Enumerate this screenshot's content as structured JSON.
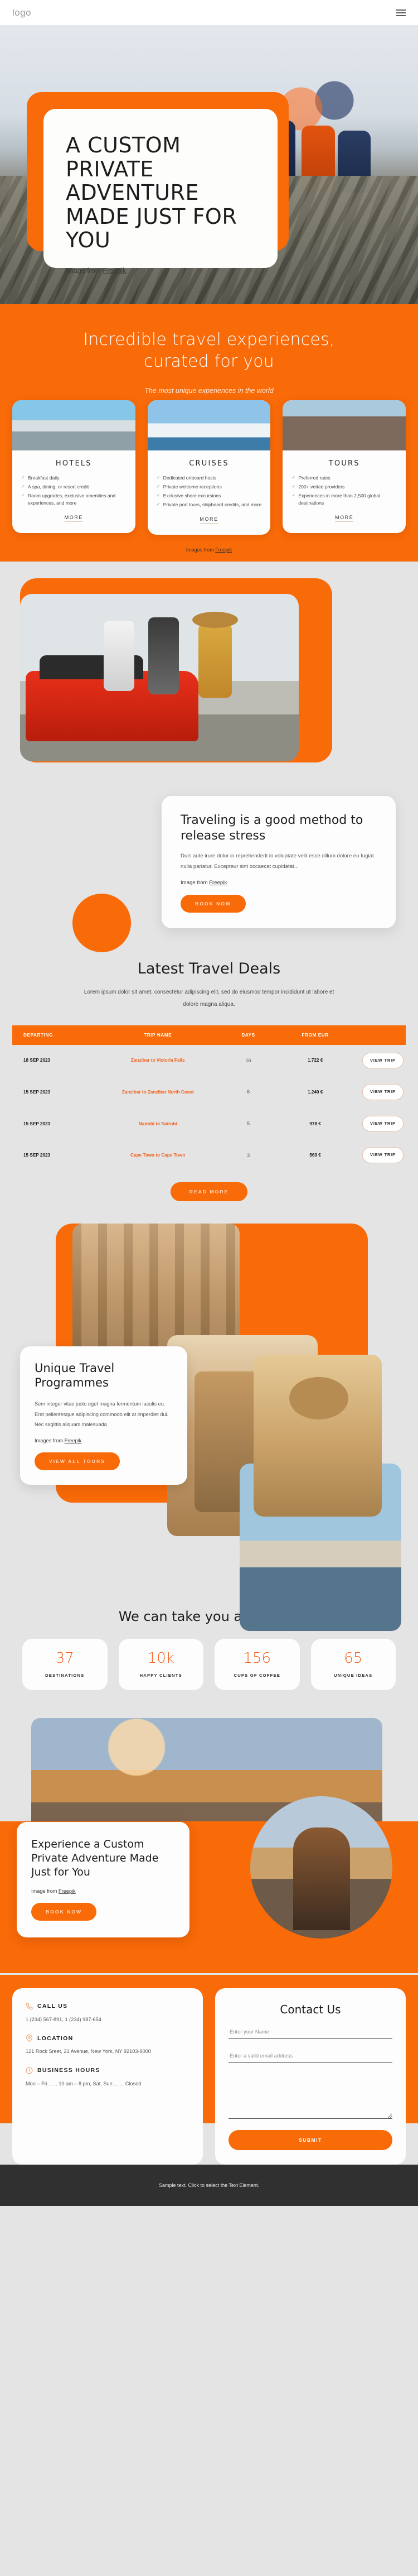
{
  "header": {
    "logo": "logo",
    "menu_icon": "hamburger-icon"
  },
  "hero": {
    "title": "A CUSTOM PRIVATE ADVENTURE MADE JUST FOR YOU",
    "credit_prefix": "Image from ",
    "credit_link": "Freepik"
  },
  "experiences": {
    "heading": "Incredible travel experiences, curated for you",
    "subheading": "The most unique experiences in the world",
    "credit_prefix": "Images from ",
    "credit_link": "Freepik",
    "cards": [
      {
        "title": "HOTELS",
        "features": [
          "Breakfast daily",
          "A spa, dining, or resort credit",
          "Room upgrades, exclusive amenities and experiences, and more"
        ],
        "more_label": "MORE"
      },
      {
        "title": "CRUISES",
        "features": [
          "Dedicated onboard hosts",
          "Private welcome receptions",
          "Exclusive shore excursions",
          "Private port tours, shipboard credits, and more"
        ],
        "more_label": "MORE"
      },
      {
        "title": "TOURS",
        "features": [
          "Preferred rates",
          "200+ vetted providers",
          "Experiences in more than 2,500 global destinations"
        ],
        "more_label": "MORE"
      }
    ]
  },
  "stress": {
    "title": "Traveling is a good method to release stress",
    "body": "Duis aute irure dolor in reprehenderit in voluptate velit esse cillum dolore eu fugiat nulla pariatur. Excepteur sint occaecat cupidatat...",
    "credit_prefix": "Image from ",
    "credit_link": "Freepik",
    "button": "BOOK NOW"
  },
  "deals": {
    "heading": "Latest Travel Deals",
    "lead": "Lorem ipsum dolor sit amet, consectetur adipiscing elit, sed do eiusmod tempor incididunt ut labore et dolore magna aliqua.",
    "columns": [
      "DEPARTING",
      "TRIP NAME",
      "DAYS",
      "FROM EUR"
    ],
    "rows": [
      {
        "departing": "18 SEP 2023",
        "trip": "Zanzibar to Victoria Falls",
        "days": "16",
        "price": "1.722 €",
        "action": "VIEW TRIP"
      },
      {
        "departing": "15 SEP 2023",
        "trip": "Zanzibar to Zanzibar North Coast",
        "days": "6",
        "price": "1.240 €",
        "action": "VIEW TRIP"
      },
      {
        "departing": "15 SEP 2023",
        "trip": "Nairobi to Nairobi",
        "days": "5",
        "price": "978 €",
        "action": "VIEW TRIP"
      },
      {
        "departing": "15 SEP 2023",
        "trip": "Cape Town to Cape Town",
        "days": "3",
        "price": "569 €",
        "action": "VIEW TRIP"
      }
    ],
    "read_more": "READ MORE"
  },
  "programmes": {
    "title": "Unique Travel Programmes",
    "body": "Sem integer vitae justo eget magna fermentum iaculis eu. Erat pellentesque adipiscing commodo elit at imperdiet dui. Nec sagittis aliquam malesuada",
    "credit_prefix": "Images from ",
    "credit_link": "Freepik",
    "button": "VIEW ALL TOURS"
  },
  "stats": {
    "heading": "We can take you anywhere",
    "items": [
      {
        "number": "37",
        "label": "DESTINATIONS"
      },
      {
        "number": "10k",
        "label": "HAPPY CLIENTS"
      },
      {
        "number": "156",
        "label": "CUPS OF COFFEE"
      },
      {
        "number": "65",
        "label": "UNIQUE IDEAS"
      }
    ]
  },
  "cta": {
    "title": "Experience a Custom Private Adventure Made Just for You",
    "credit_prefix": "Image from ",
    "credit_link": "Freepik",
    "button": "BOOK NOW"
  },
  "contact": {
    "call": {
      "icon": "phone-icon",
      "title": "CALL US",
      "value": "1 (234) 567-891, 1 (234) 987-654"
    },
    "location": {
      "icon": "map-pin-icon",
      "title": "LOCATION",
      "value": "121 Rock Sreet, 21 Avenue, New York, NY 92103-9000"
    },
    "hours": {
      "icon": "clock-24-icon",
      "title": "BUSINESS HOURS",
      "value": "Mon – Fri ...... 10 am – 8 pm, Sat, Sun ....... Closed"
    },
    "form": {
      "heading": "Contact Us",
      "name_placeholder": "Enter your Name",
      "email_placeholder": "Enter a valid email address",
      "message_placeholder": "",
      "submit_label": "SUBMIT"
    }
  },
  "footer": {
    "text": "Sample text. Click to select the Text Element."
  },
  "colors": {
    "accent": "#f96a08",
    "page_bg": "#e4e4e4",
    "dark": "#303030"
  }
}
